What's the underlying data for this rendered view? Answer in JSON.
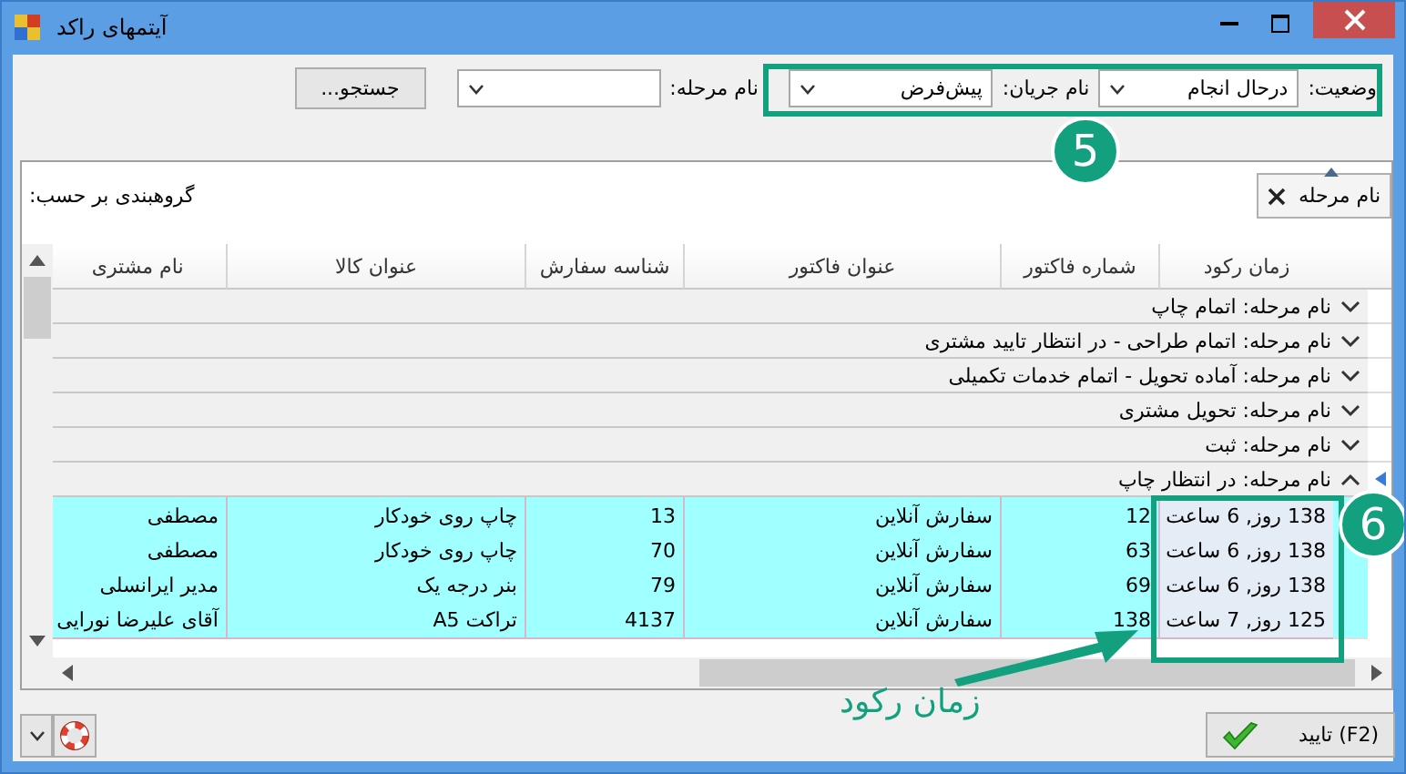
{
  "window": {
    "title": "آیتمهای راکد"
  },
  "filters": {
    "status": {
      "label": "وضعیت:",
      "value": "درحال انجام"
    },
    "flow": {
      "label": "نام جریان:",
      "value": "پیش‌فرض"
    },
    "stage": {
      "label": "نام مرحله:"
    },
    "search_button": "جستجو..."
  },
  "grid": {
    "group_panel": {
      "label": "گروهبندی بر حسب:",
      "chips": [
        {
          "label": "نام مرحله"
        }
      ]
    },
    "columns": [
      "زمان رکود",
      "شماره فاکتور",
      "عنوان فاکتور",
      "شناسه سفارش",
      "عنوان کالا",
      "نام مشتری"
    ],
    "groups": [
      {
        "label": "نام مرحله: اتمام چاپ",
        "expanded": false,
        "selected": false
      },
      {
        "label": "نام مرحله: اتمام طراحی - در انتظار تایید مشتری",
        "expanded": false,
        "selected": false
      },
      {
        "label": "نام مرحله: آماده تحویل - اتمام خدمات تکمیلی",
        "expanded": false,
        "selected": false
      },
      {
        "label": "نام مرحله: تحویل مشتری",
        "expanded": false,
        "selected": false
      },
      {
        "label": "نام مرحله: ثبت",
        "expanded": false,
        "selected": false
      },
      {
        "label": "نام مرحله: در انتظار چاپ",
        "expanded": true,
        "selected": true
      }
    ],
    "rows": [
      [
        "138 روز, 6 ساعت",
        "12",
        "سفارش آنلاین",
        "13",
        "چاپ روی خودکار",
        "مصطفی"
      ],
      [
        "138 روز, 6 ساعت",
        "63",
        "سفارش آنلاین",
        "70",
        "چاپ روی خودکار",
        "مصطفی"
      ],
      [
        "138 روز, 6 ساعت",
        "69",
        "سفارش آنلاین",
        "79",
        "بنر درجه یک",
        "مدیر ایرانسلی"
      ],
      [
        "125 روز, 7 ساعت",
        "138",
        "سفارش آنلاین",
        "4137",
        "تراکت A5",
        "آقای علیرضا نورایی"
      ]
    ]
  },
  "confirm_button": "تایید (F2)",
  "annotations": [
    {
      "kind": "badge",
      "label": "5"
    },
    {
      "kind": "badge",
      "label": "6"
    },
    {
      "kind": "caption",
      "label": "زمان رکود"
    }
  ]
}
